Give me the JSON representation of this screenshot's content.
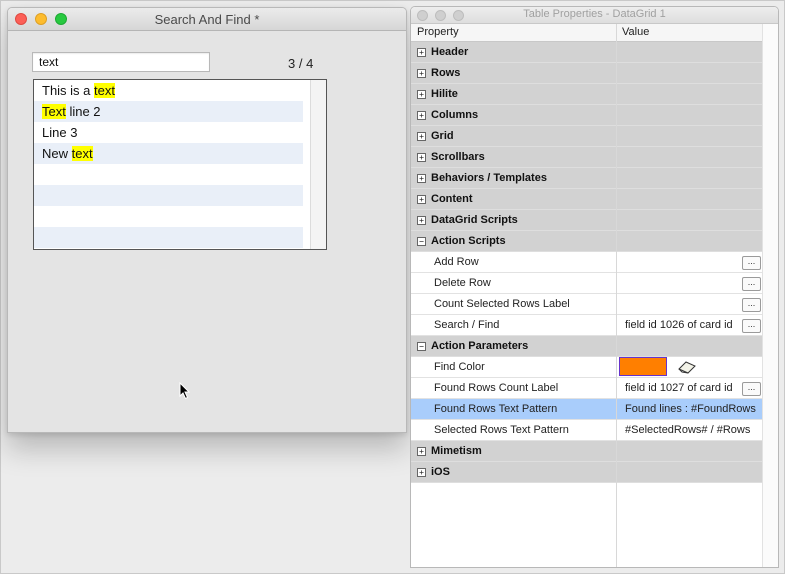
{
  "search_window": {
    "title": "Search And Find *",
    "search_value": "text",
    "match_count": "3 / 4",
    "rows": [
      {
        "parts": [
          {
            "t": "This is a ",
            "hl": false
          },
          {
            "t": "text",
            "hl": true
          }
        ]
      },
      {
        "parts": [
          {
            "t": "Text",
            "hl": true
          },
          {
            "t": " line 2",
            "hl": false
          }
        ]
      },
      {
        "parts": [
          {
            "t": "Line 3",
            "hl": false
          }
        ]
      },
      {
        "parts": [
          {
            "t": "New ",
            "hl": false
          },
          {
            "t": "text",
            "hl": true
          }
        ]
      },
      {
        "parts": []
      },
      {
        "parts": []
      },
      {
        "parts": []
      },
      {
        "parts": []
      }
    ]
  },
  "props_window": {
    "title": "Table Properties - DataGrid 1",
    "col_property": "Property",
    "col_value": "Value",
    "rows": [
      {
        "kind": "section",
        "label": "Header",
        "expander": "+"
      },
      {
        "kind": "section",
        "label": "Rows",
        "expander": "+"
      },
      {
        "kind": "section",
        "label": "Hilite",
        "expander": "+"
      },
      {
        "kind": "section",
        "label": "Columns",
        "expander": "+"
      },
      {
        "kind": "section",
        "label": "Grid",
        "expander": "+"
      },
      {
        "kind": "section",
        "label": "Scrollbars",
        "expander": "+"
      },
      {
        "kind": "section",
        "label": "Behaviors / Templates",
        "expander": "+"
      },
      {
        "kind": "section",
        "label": "Content",
        "expander": "+"
      },
      {
        "kind": "section",
        "label": "DataGrid Scripts",
        "expander": "+"
      },
      {
        "kind": "section",
        "label": "Action Scripts",
        "expander": "−"
      },
      {
        "kind": "prop",
        "label": "Add Row",
        "value": "",
        "button": "..."
      },
      {
        "kind": "prop",
        "label": "Delete Row",
        "value": "",
        "button": "..."
      },
      {
        "kind": "prop",
        "label": "Count Selected Rows Label",
        "value": "",
        "button": "..."
      },
      {
        "kind": "prop",
        "label": "Search / Find",
        "value": "field id 1026 of card id",
        "button": "..."
      },
      {
        "kind": "section",
        "label": "Action Parameters",
        "expander": "−"
      },
      {
        "kind": "color",
        "label": "Find Color",
        "color": "#ff7f00"
      },
      {
        "kind": "prop",
        "label": "Found Rows Count Label",
        "value": "field id 1027 of card id",
        "button": "..."
      },
      {
        "kind": "prop",
        "label": "Found Rows Text Pattern",
        "value": "Found lines : #FoundRows",
        "selected": true
      },
      {
        "kind": "prop",
        "label": "Selected Rows Text Pattern",
        "value": "#SelectedRows# / #Rows"
      },
      {
        "kind": "section",
        "label": "Mimetism",
        "expander": "+"
      },
      {
        "kind": "section",
        "label": "iOS",
        "expander": "+"
      }
    ]
  }
}
